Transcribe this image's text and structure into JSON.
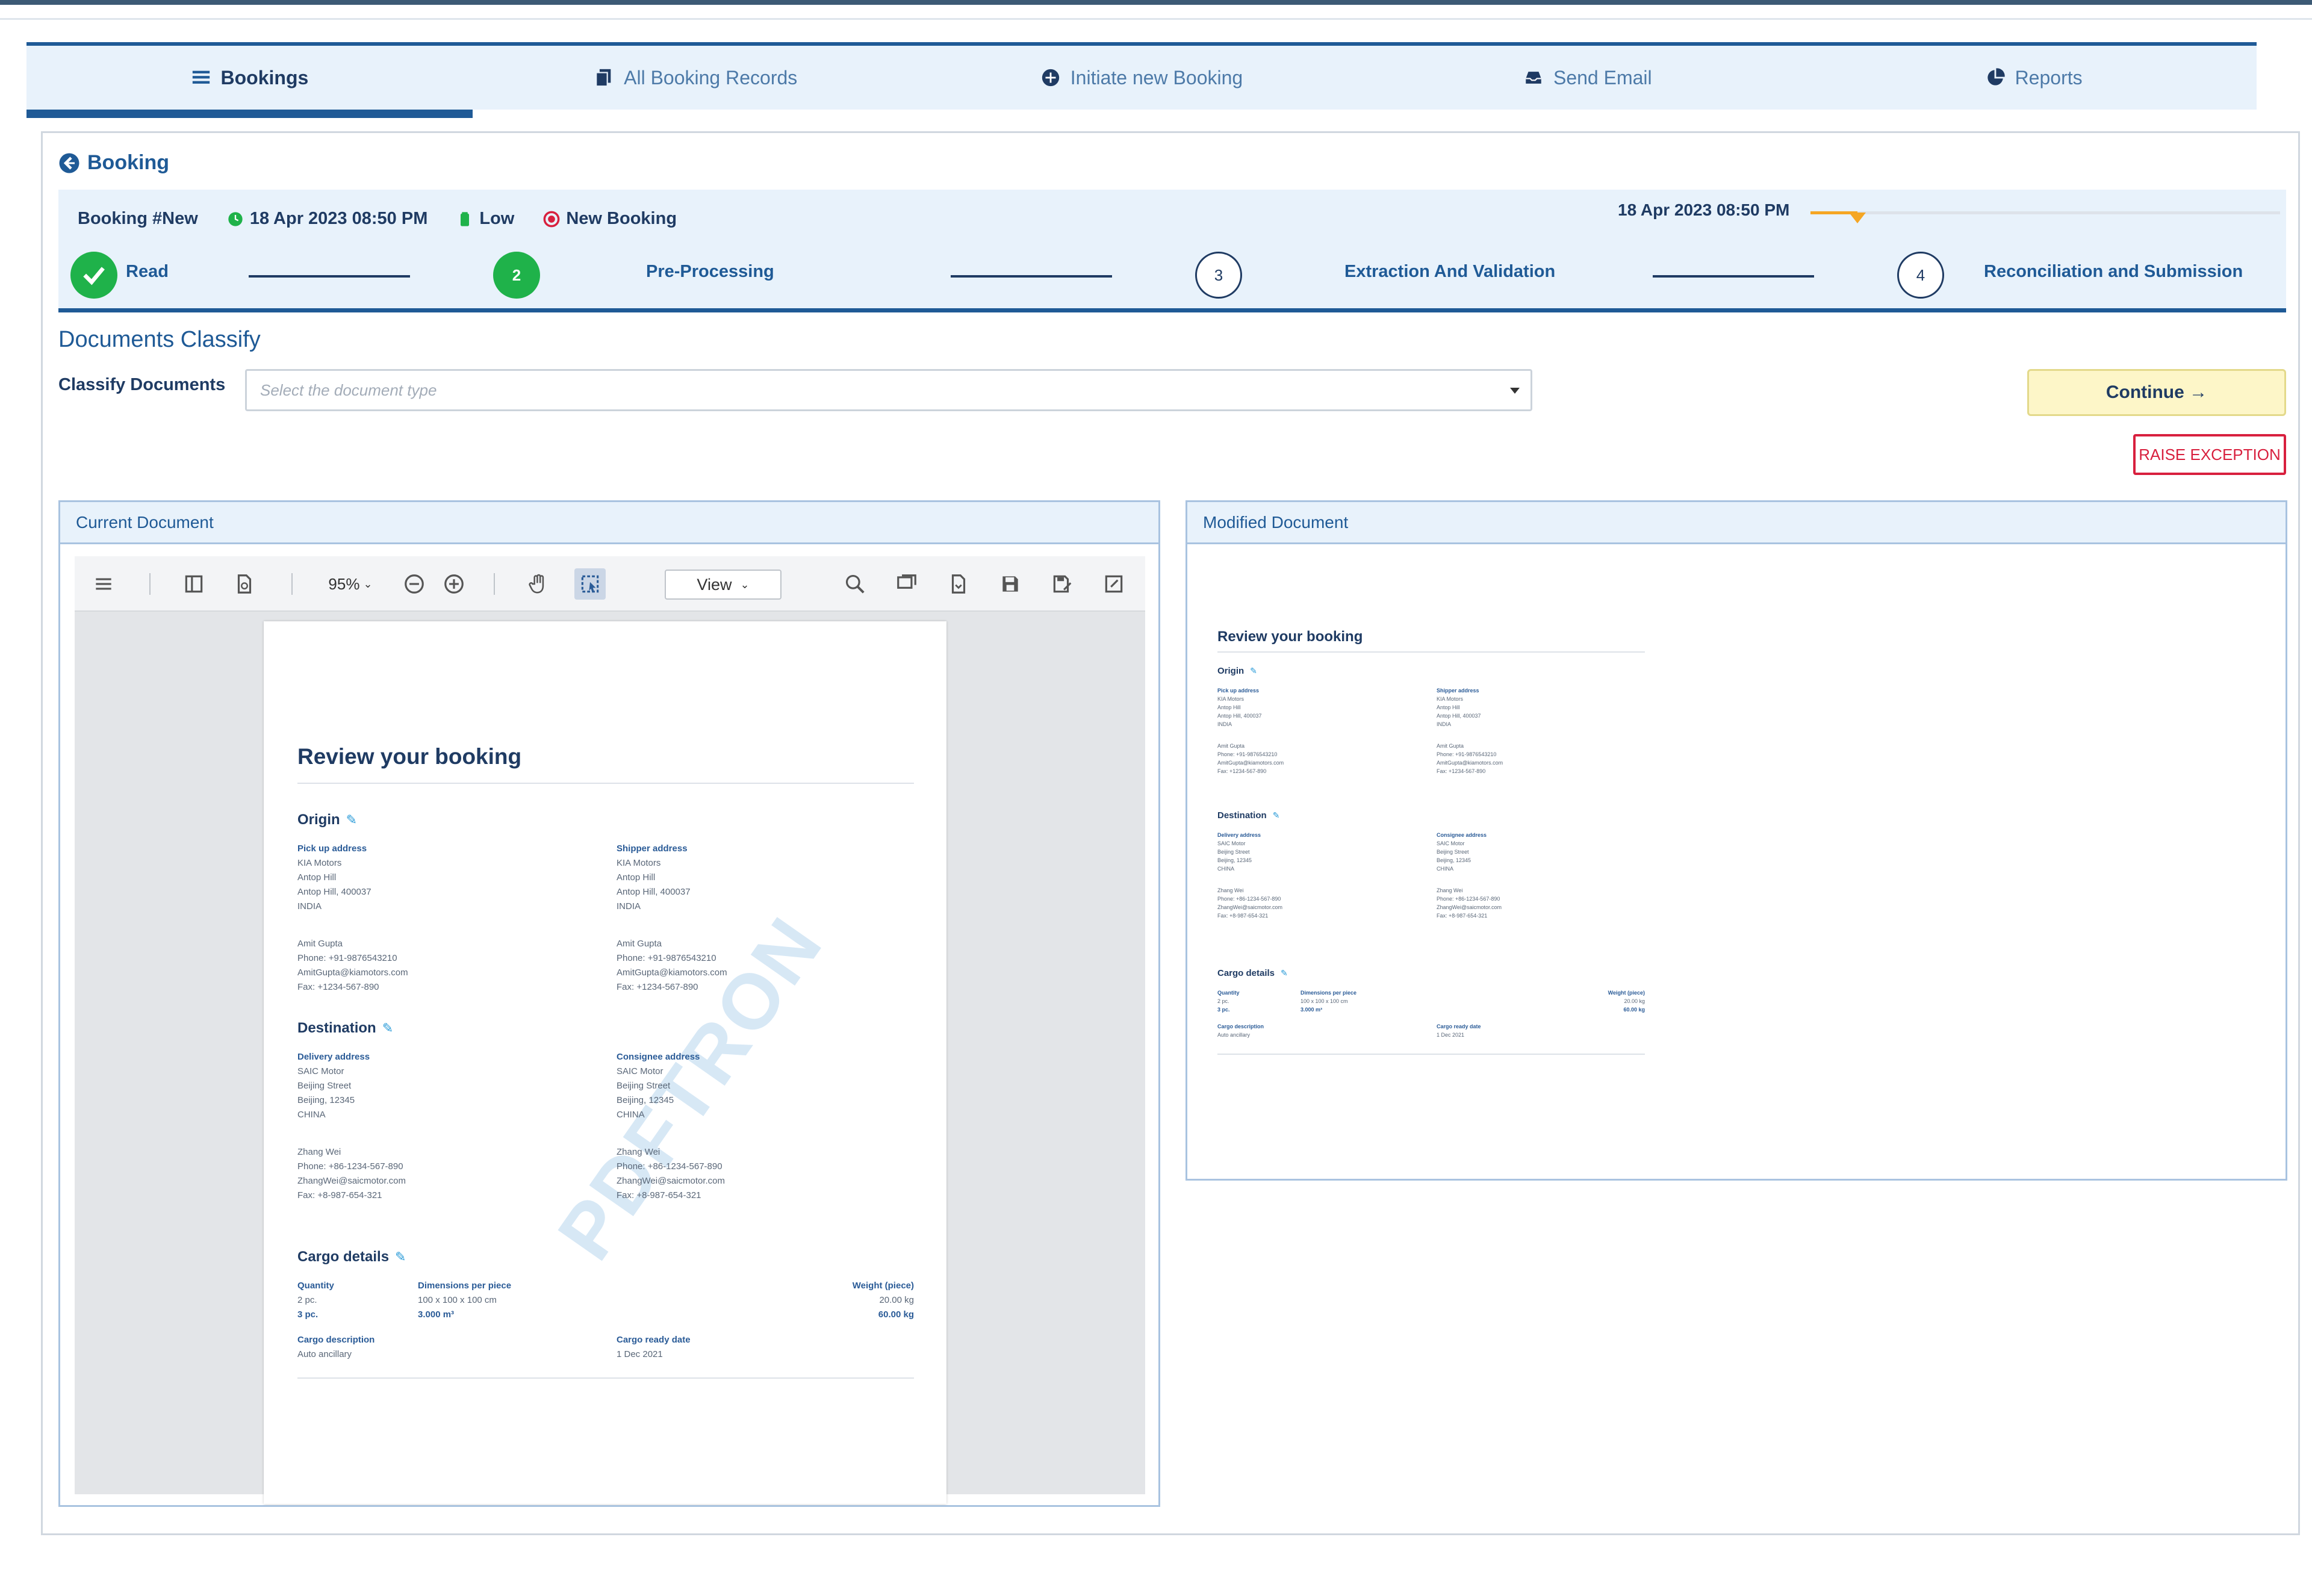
{
  "tabs": [
    {
      "label": "Bookings",
      "icon": "list-icon",
      "active": true
    },
    {
      "label": "All Booking Records",
      "icon": "copy-icon",
      "active": false
    },
    {
      "label": "Initiate new Booking",
      "icon": "plus-circle-icon",
      "active": false
    },
    {
      "label": "Send Email",
      "icon": "inbox-icon",
      "active": false
    },
    {
      "label": "Reports",
      "icon": "pie-chart-icon",
      "active": false
    }
  ],
  "back_label": "Booking",
  "booking": {
    "id": "Booking #New",
    "date": "18 Apr 2023 08:50 PM",
    "priority": "Low",
    "status": "New Booking",
    "progress_date": "18 Apr 2023 08:50 PM",
    "progress_fraction": 0.1
  },
  "steps": [
    {
      "number": "",
      "label": "Read",
      "state": "done"
    },
    {
      "number": "2",
      "label": "Pre-Processing",
      "state": "current"
    },
    {
      "number": "3",
      "label": "Extraction And Validation",
      "state": "todo"
    },
    {
      "number": "4",
      "label": "Reconciliation and Submission",
      "state": "todo"
    }
  ],
  "section_title": "Documents Classify",
  "classify": {
    "label": "Classify Documents",
    "placeholder": "Select the document type"
  },
  "continue_label": "Continue →",
  "raise_label": "RAISE EXCEPTION",
  "current_doc_title": "Current Document",
  "modified_doc_title": "Modified Document",
  "viewer": {
    "zoom": "95%",
    "mode": "View"
  },
  "document": {
    "title": "Review your booking",
    "watermark": "PDFTRON",
    "origin": {
      "heading": "Origin",
      "pickup_heading": "Pick up address",
      "pickup_lines": [
        "KIA Motors",
        "Antop Hill",
        "Antop Hill, 400037",
        "INDIA"
      ],
      "shipper_heading": "Shipper address",
      "shipper_lines": [
        "KIA Motors",
        "Antop Hill",
        "Antop Hill, 400037",
        "INDIA"
      ],
      "contact_left": [
        "Amit Gupta",
        "Phone: +91-9876543210",
        "AmitGupta@kiamotors.com",
        "Fax: +1234-567-890"
      ],
      "contact_right": [
        "Amit Gupta",
        "Phone: +91-9876543210",
        "AmitGupta@kiamotors.com",
        "Fax: +1234-567-890"
      ]
    },
    "destination": {
      "heading": "Destination",
      "delivery_heading": "Delivery address",
      "delivery_lines": [
        "SAIC Motor",
        "Beijing Street",
        "Beijing, 12345",
        "CHINA"
      ],
      "consignee_heading": "Consignee address",
      "consignee_lines": [
        "SAIC Motor",
        "Beijing Street",
        "Beijing, 12345",
        "CHINA"
      ],
      "contact_left": [
        "Zhang Wei",
        "Phone: +86-1234-567-890",
        "ZhangWei@saicmotor.com",
        "Fax: +8-987-654-321"
      ],
      "contact_right": [
        "Zhang Wei",
        "Phone: +86-1234-567-890",
        "ZhangWei@saicmotor.com",
        "Fax: +8-987-654-321"
      ]
    },
    "cargo": {
      "heading": "Cargo details",
      "quantity_heading": "Quantity",
      "dimensions_heading": "Dimensions per piece",
      "weight_heading": "Weight (piece)",
      "row1": [
        "2 pc.",
        "100 x 100 x 100 cm",
        "20.00 kg"
      ],
      "row2": [
        "3 pc.",
        "3.000 m³",
        "60.00 kg"
      ],
      "desc_heading": "Cargo description",
      "desc_value": "Auto ancillary",
      "ready_heading": "Cargo ready date",
      "ready_value": "1 Dec 2021"
    }
  },
  "colors": {
    "primary": "#1f5a96",
    "success": "#1fb24a",
    "warning": "#f5a623",
    "danger": "#d8203e",
    "continue_bg": "#fdf6c8"
  }
}
